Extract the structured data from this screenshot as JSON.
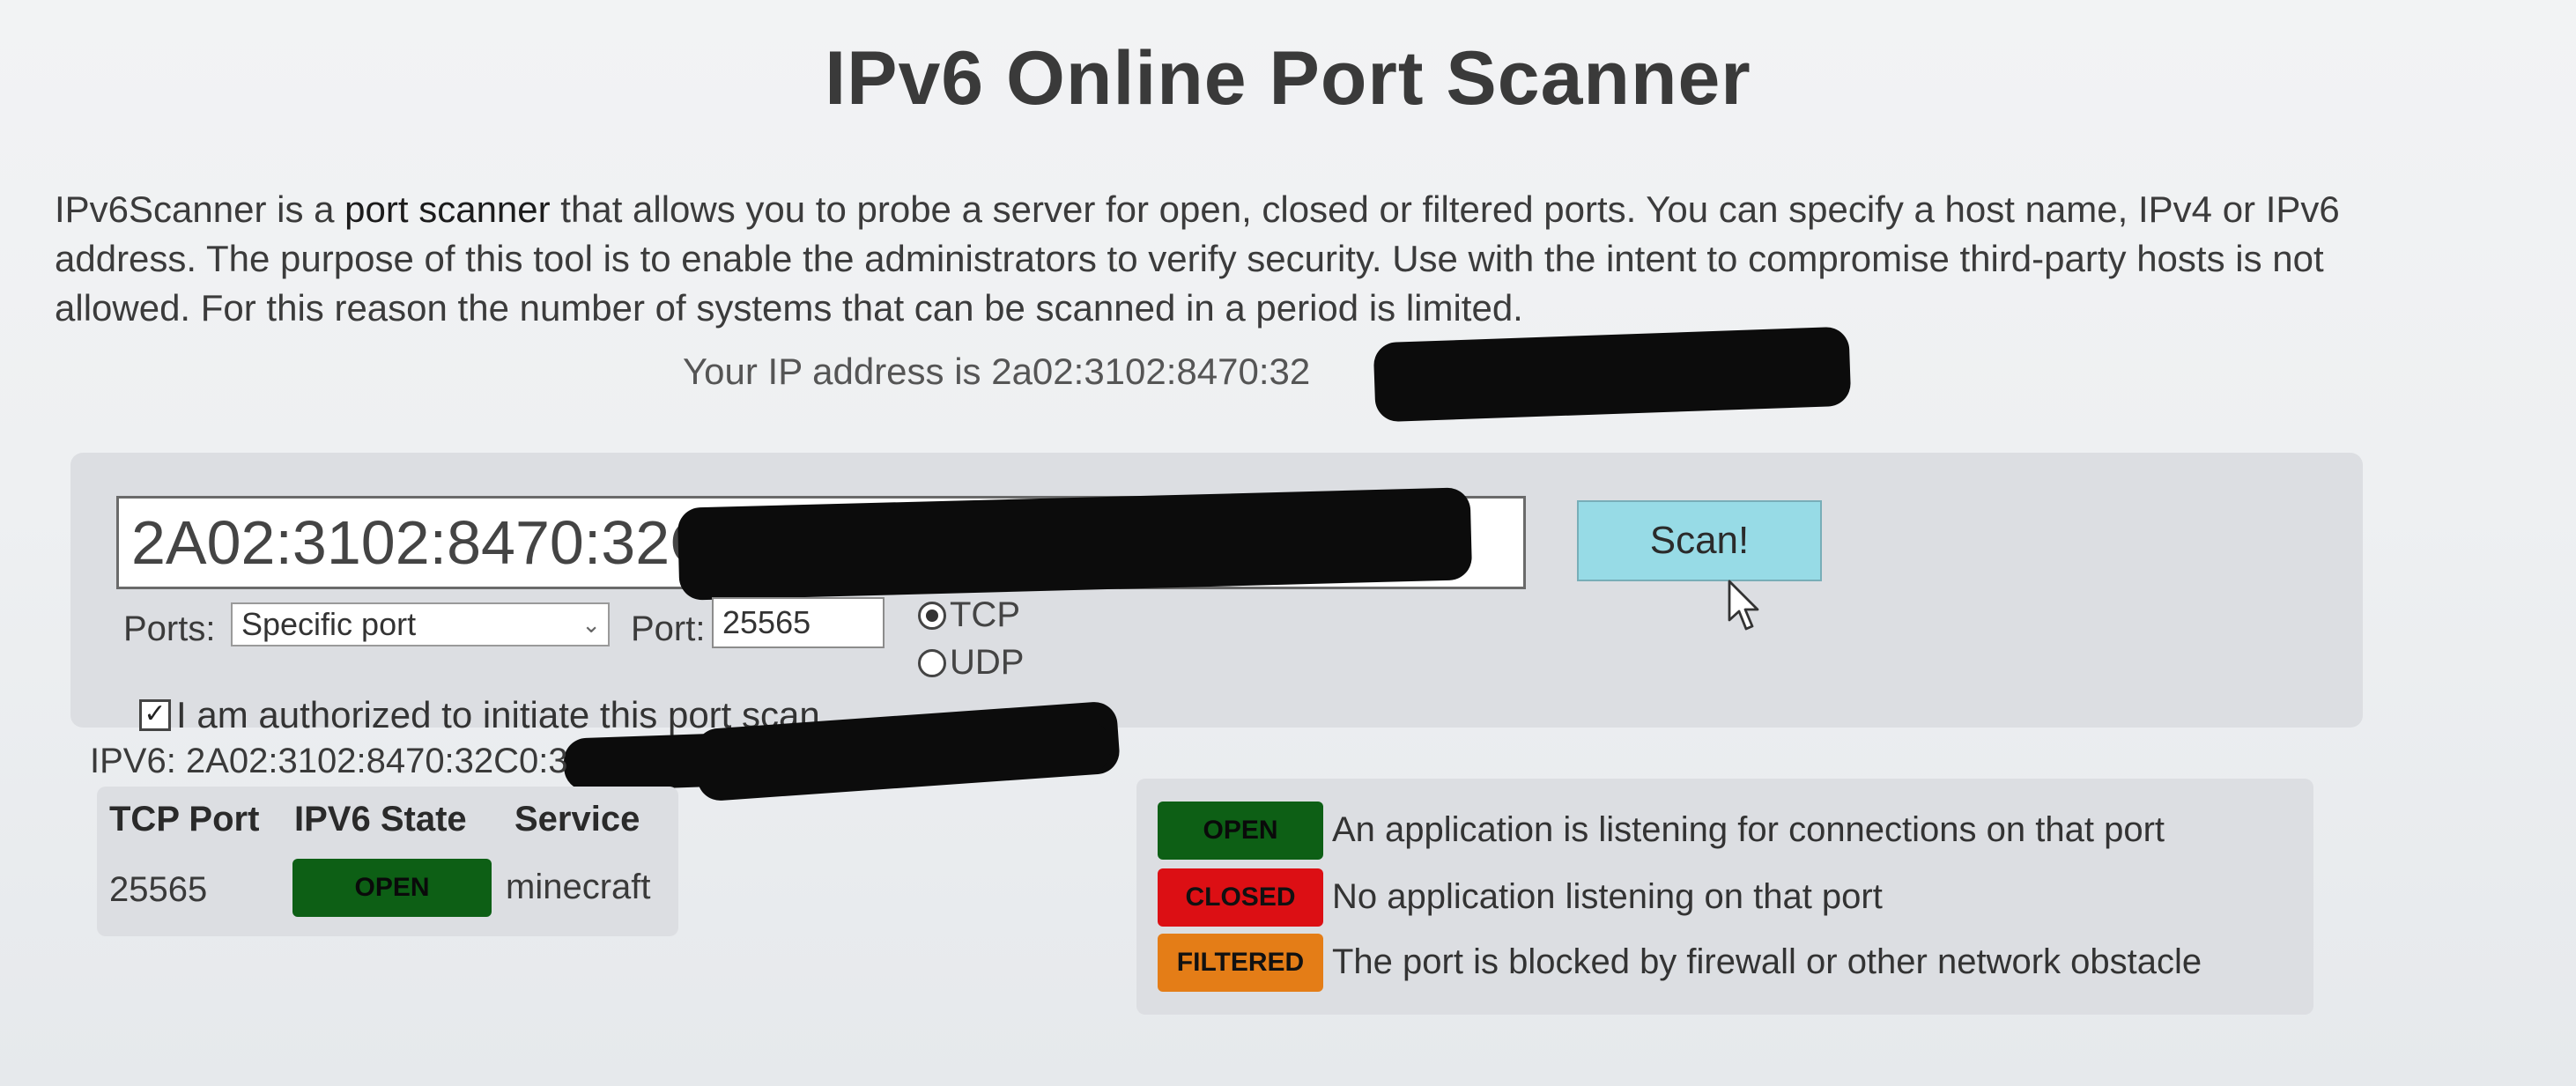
{
  "page": {
    "title": "IPv6 Online Port Scanner",
    "intro_before_link": "IPv6Scanner is a ",
    "intro_link": "port scanner",
    "intro_after_link": " that allows you to probe a server for open, closed or filtered ports. You can specify a host name, IPv4 or IPv6 address. The purpose of this tool is to enable the administrators to verify security. Use with the intent to compromise third-party hosts is not allowed. For this reason the number of systems that can be scanned in a period is limited.",
    "ip_line": "Your IP address is 2a02:3102:8470:32"
  },
  "form": {
    "host_value": "2A02:3102:8470:32C0",
    "scan_label": "Scan!",
    "ports_label": "Ports:",
    "ports_selected": "Specific port",
    "port_label": "Port:",
    "port_value": "25565",
    "protocol_tcp": "TCP",
    "protocol_udp": "UDP",
    "protocol_selected": "TCP",
    "authorized_checked": true,
    "authorized_text": "I am authorized to initiate this port scan",
    "icons": {
      "select_chevron": "chevron-down-icon",
      "checkbox_mark": "checkmark-icon",
      "cursor": "mouse-cursor-icon"
    }
  },
  "results": {
    "ipv6_line": "IPV6: 2A02:3102:8470:32C0:3",
    "headers": [
      "TCP Port",
      "IPV6 State",
      "Service"
    ],
    "rows": [
      {
        "port": "25565",
        "state": "OPEN",
        "service": "minecraft"
      }
    ]
  },
  "legend": [
    {
      "badge": "OPEN",
      "text": "An application is listening for connections on that port",
      "color": "#0d5f15"
    },
    {
      "badge": "CLOSED",
      "text": "No application listening on that port",
      "color": "#dc0f14"
    },
    {
      "badge": "FILTERED",
      "text": "The port is blocked by firewall or other network obstacle",
      "color": "#e47d17"
    }
  ],
  "colors": {
    "scan_button": "#97dbe6",
    "panel": "#dcdee2",
    "redaction": "#0c0c0c"
  }
}
